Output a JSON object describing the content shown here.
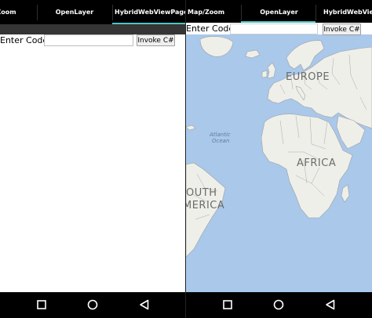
{
  "left_screen": {
    "tabs": [
      {
        "label": "Zoom",
        "active": false
      },
      {
        "label": "OpenLayer",
        "active": false
      },
      {
        "label": "HybridWebViewPage",
        "active": true
      }
    ],
    "code_label": "Enter Code:",
    "code_value": "",
    "invoke_label": "Invoke C#"
  },
  "right_screen": {
    "tabs": [
      {
        "label": "Map/Zoom",
        "active": false
      },
      {
        "label": "OpenLayer",
        "active": true
      },
      {
        "label": "HybridWebViewPa",
        "active": false
      }
    ],
    "code_label": "Enter Code:",
    "code_value": "",
    "invoke_label": "Invoke C#",
    "map": {
      "labels": {
        "europe": "EUROPE",
        "africa": "AFRICA",
        "south_america_line1": "OUTH",
        "south_america_line2": "MERICA",
        "ocean_line1": "Atlantic",
        "ocean_line2": "Ocean"
      },
      "colors": {
        "water": "#a9c8ea",
        "land": "#efefea",
        "borders": "#9a9a9a"
      }
    }
  },
  "nav_buttons": [
    "recent-apps",
    "home",
    "back"
  ],
  "colors": {
    "tab_bar": "#000000",
    "tab_indicator": "#4cc5c5",
    "status_strip": "#353535",
    "nav_bar": "#000000"
  }
}
